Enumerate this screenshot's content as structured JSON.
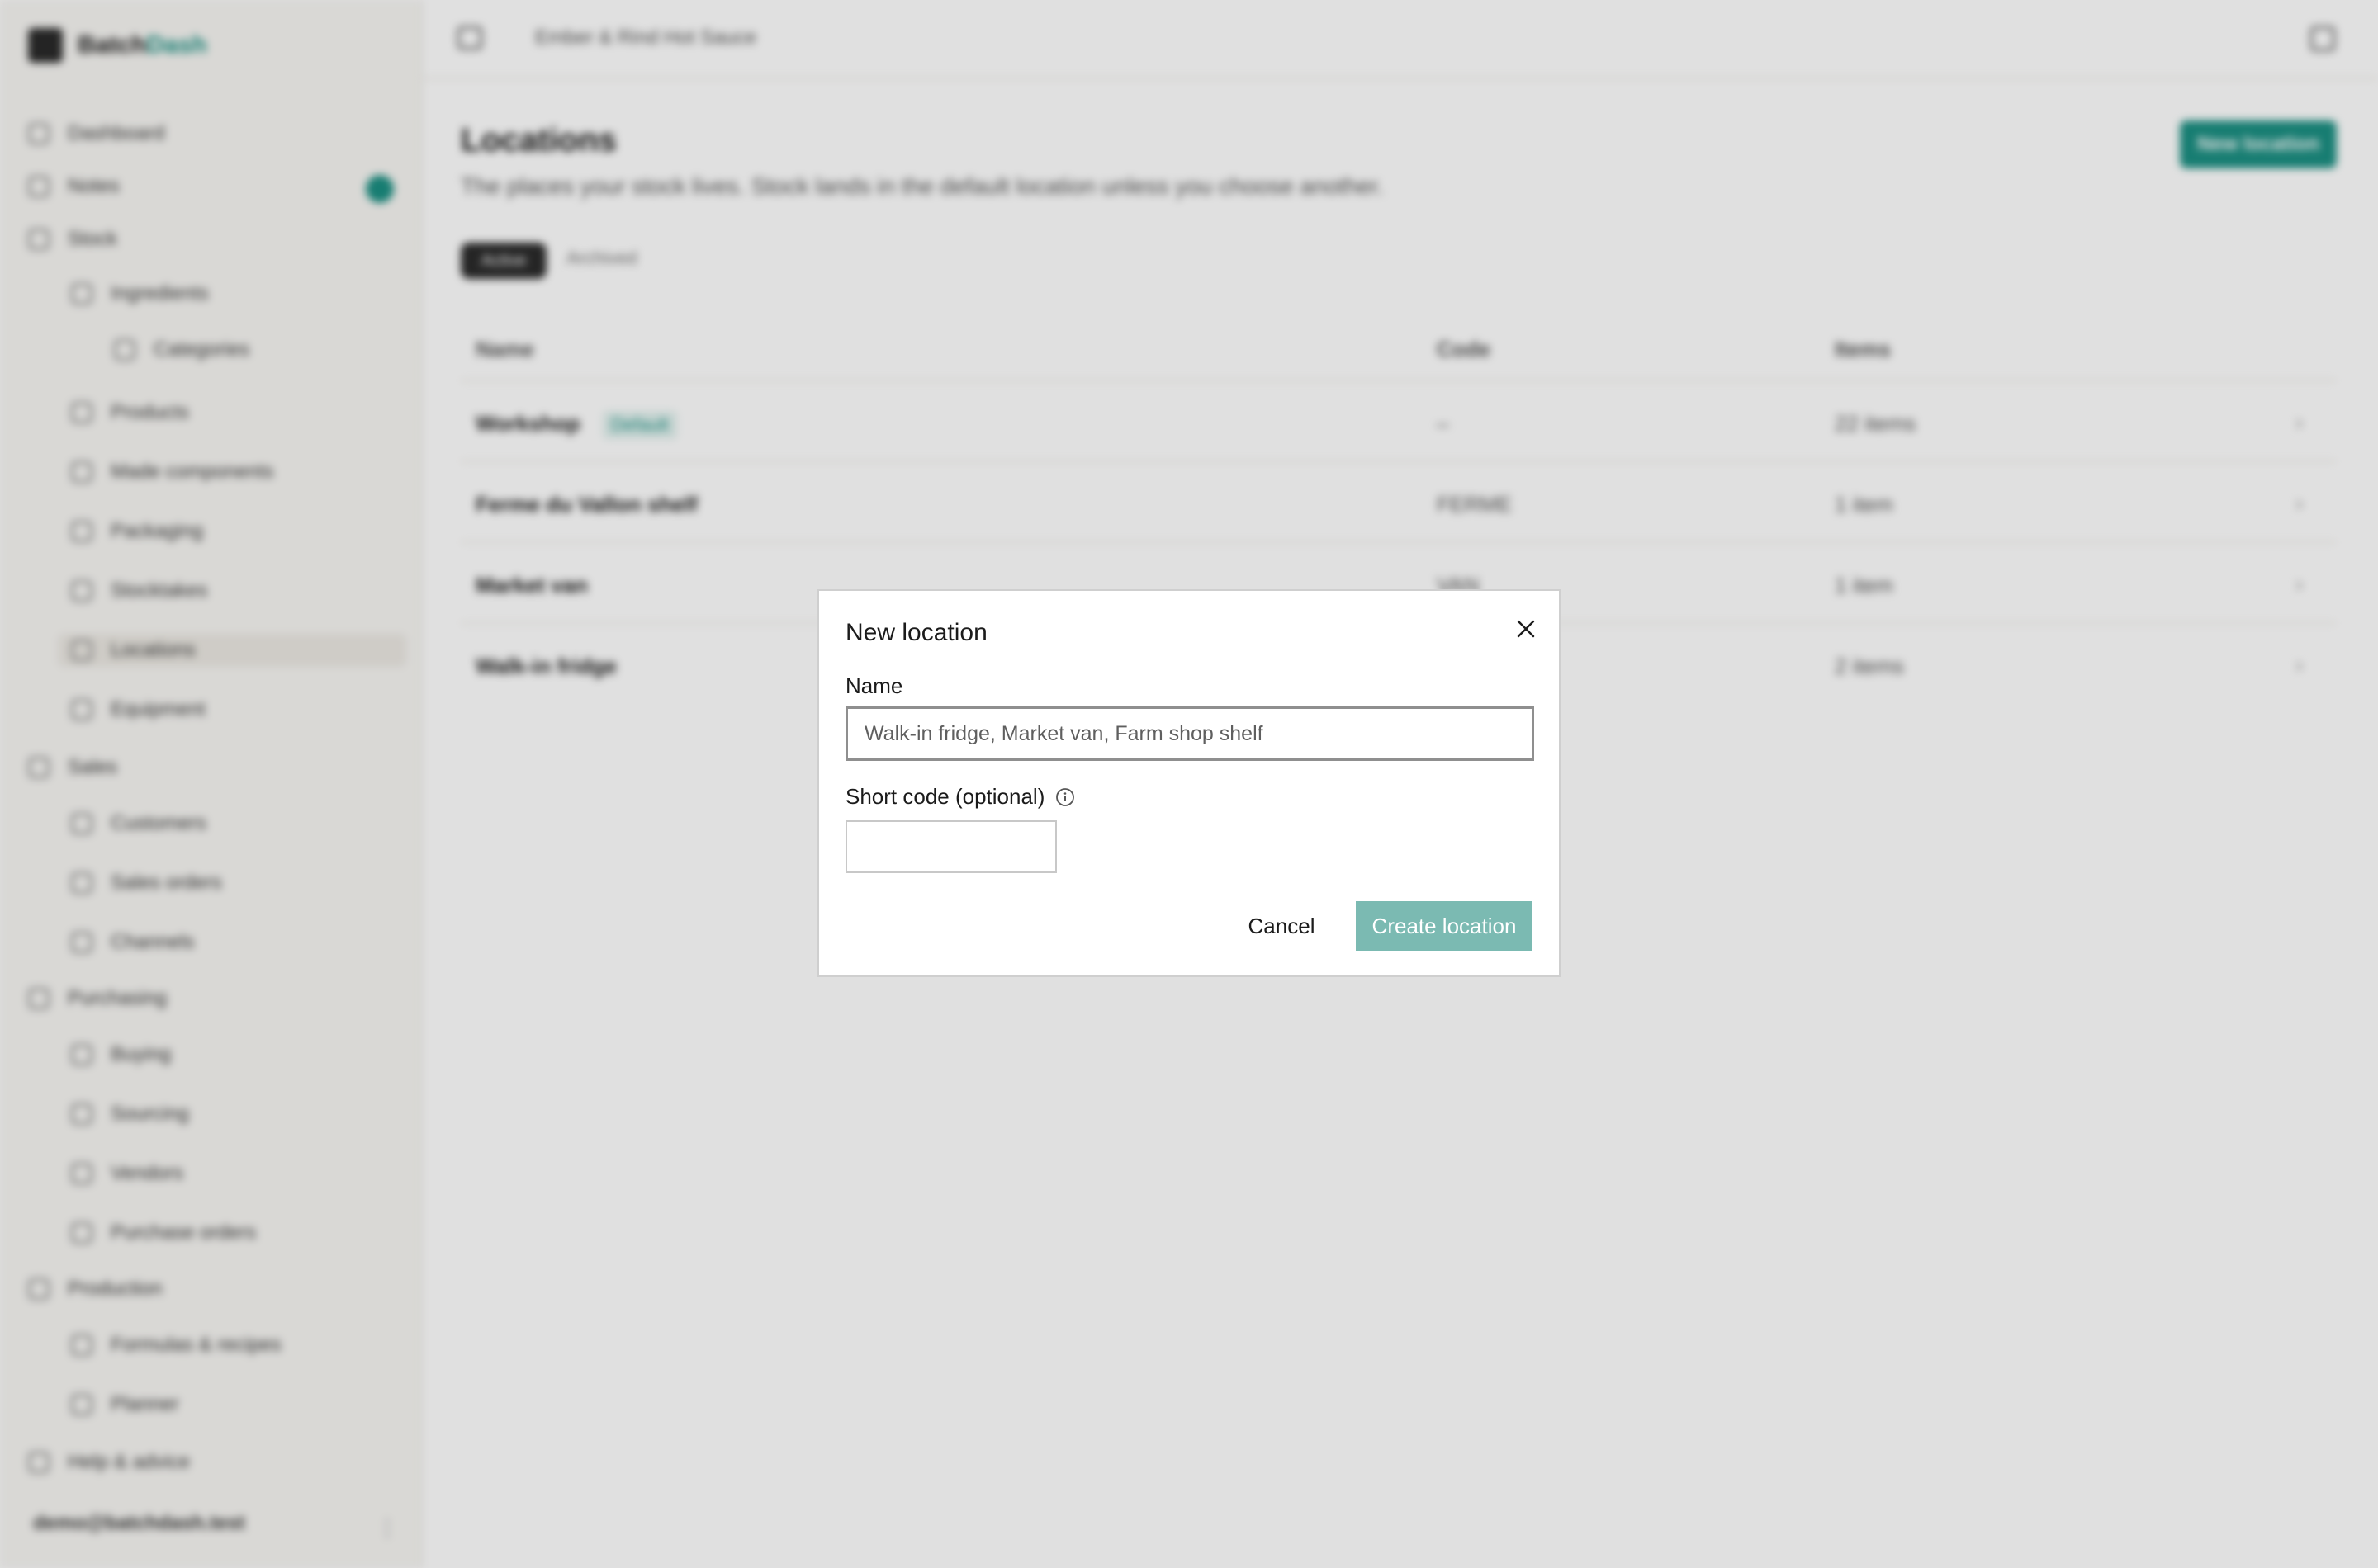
{
  "app": {
    "brand_prefix": "Batch",
    "brand_suffix": "Dash",
    "breadcrumb": "Ember & Rind Hot Sauce",
    "accent_color": "#1b8f82"
  },
  "sidebar": {
    "items": [
      {
        "label": "Dashboard"
      },
      {
        "label": "Notes"
      },
      {
        "label": "Stock"
      },
      {
        "label": "Ingredients"
      },
      {
        "label": "Categories"
      },
      {
        "label": "Products"
      },
      {
        "label": "Made components"
      },
      {
        "label": "Packaging"
      },
      {
        "label": "Stocktakes"
      },
      {
        "label": "Locations"
      },
      {
        "label": "Equipment"
      },
      {
        "label": "Sales"
      },
      {
        "label": "Customers"
      },
      {
        "label": "Sales orders"
      },
      {
        "label": "Channels"
      },
      {
        "label": "Purchasing"
      },
      {
        "label": "Buying"
      },
      {
        "label": "Sourcing"
      },
      {
        "label": "Vendors"
      },
      {
        "label": "Purchase orders"
      },
      {
        "label": "Production"
      },
      {
        "label": "Formulas & recipes"
      },
      {
        "label": "Planner"
      },
      {
        "label": "Help & advice"
      }
    ],
    "user_email": "demo@batchdash.test",
    "user_menu_icon": "⋮"
  },
  "page": {
    "title": "Locations",
    "subtitle": "The places your stock lives. Stock lands in the default location unless you choose another.",
    "new_button": "New location",
    "tabs": [
      "Active",
      "Archived"
    ],
    "columns": [
      "Name",
      "Code",
      "Items"
    ],
    "default_badge": "Default",
    "rows": [
      {
        "name": "Workshop",
        "code": "–",
        "items": "22 items"
      },
      {
        "name": "Ferme du Vallon shelf",
        "code": "FERME",
        "items": "1 item"
      },
      {
        "name": "Market van",
        "code": "VAN",
        "items": "1 item"
      },
      {
        "name": "Walk-in fridge",
        "code": "",
        "items": "2 items"
      }
    ],
    "row_chevron": "›"
  },
  "modal": {
    "title": "New location",
    "name_label": "Name",
    "name_placeholder": "Walk-in fridge, Market van, Farm shop shelf",
    "name_value": "",
    "code_label": "Short code (optional)",
    "code_value": "",
    "cancel_label": "Cancel",
    "create_label": "Create location",
    "create_button_color": "#7bbab2"
  }
}
